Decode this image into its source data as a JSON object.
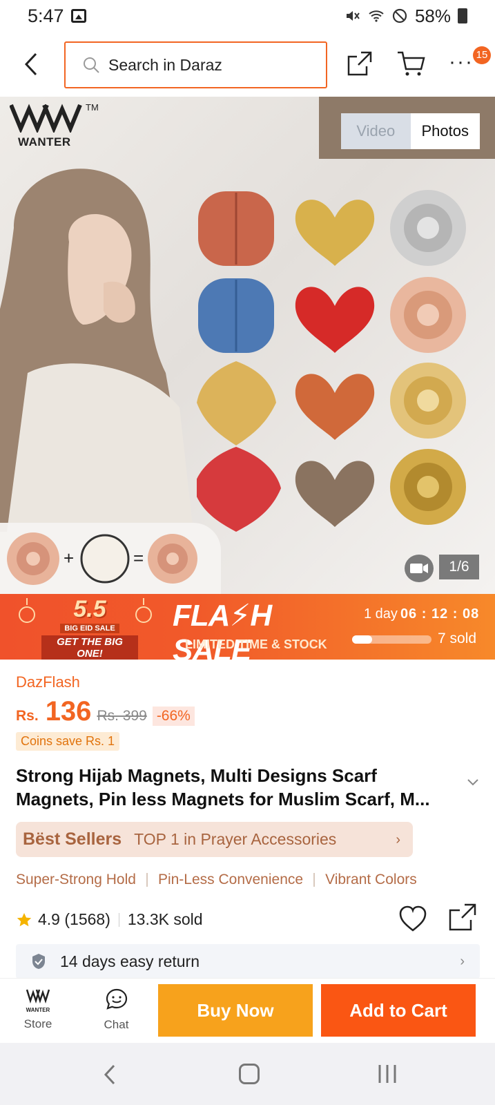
{
  "status_bar": {
    "time": "5:47",
    "battery": "58%"
  },
  "top_nav": {
    "search_placeholder": "Search in Daraz",
    "cart_badge": "15"
  },
  "gallery": {
    "brand": "WANTER",
    "brand_tm": "TM",
    "tabs": [
      "Video",
      "Photos"
    ],
    "active_tab": "Photos",
    "page_indicator": "1/6"
  },
  "flash_sale": {
    "event_big": "5.5",
    "event_line1": "BIG EID SALE",
    "event_line2": "GET THE BIG ONE!",
    "title": "FLA⚡H SALE",
    "subtitle": "LIMITED TIME & STOCK",
    "countdown_days": "1 day",
    "countdown_time": "06 : 12 : 08",
    "sold": "7 sold",
    "sold_progress": 0.25
  },
  "product": {
    "campaign": "DazFlash",
    "currency": "Rs.",
    "price": "136",
    "old_price": "Rs. 399",
    "discount": "-66%",
    "coins": "Coins save Rs. 1",
    "title": "Strong Hijab Magnets, Multi Designs Scarf Magnets, Pin less Magnets for Muslim Scarf, M...",
    "best_sellers_label": "Bëst Sellers",
    "best_sellers_text": "TOP 1 in Prayer Accessories",
    "features": [
      "Super-Strong Hold",
      "Pin-Less Convenience",
      "Vibrant Colors"
    ],
    "rating": "4.9",
    "reviews": "(1568)",
    "sold": "13.3K sold",
    "return_policy": "14 days easy return"
  },
  "bottom_bar": {
    "store_label": "Store",
    "store_logo_text": "WANTER",
    "chat_label": "Chat",
    "buy_now": "Buy Now",
    "add_to_cart": "Add to Cart"
  },
  "colors": {
    "accent": "#f26522",
    "buy_now": "#f7a21c",
    "add_to_cart": "#fa5613"
  }
}
